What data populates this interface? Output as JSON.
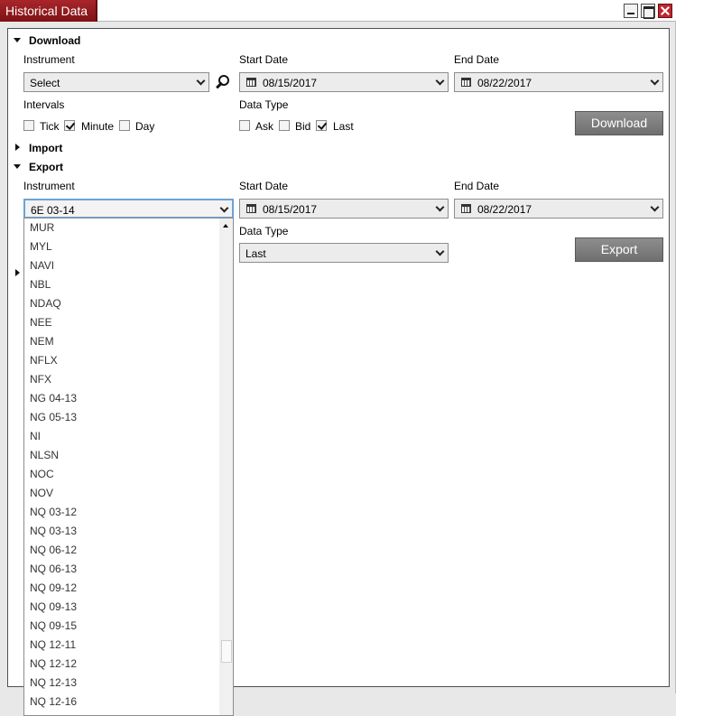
{
  "window": {
    "title": "Historical Data"
  },
  "download": {
    "section_title": "Download",
    "instrument_label": "Instrument",
    "instrument_value": "Select",
    "start_date_label": "Start Date",
    "start_date_value": "08/15/2017",
    "end_date_label": "End Date",
    "end_date_value": "08/22/2017",
    "intervals_label": "Intervals",
    "intervals": [
      {
        "label": "Tick",
        "checked": false
      },
      {
        "label": "Minute",
        "checked": true
      },
      {
        "label": "Day",
        "checked": false
      }
    ],
    "data_type_label": "Data Type",
    "data_types": [
      {
        "label": "Ask",
        "checked": false
      },
      {
        "label": "Bid",
        "checked": false
      },
      {
        "label": "Last",
        "checked": true
      }
    ],
    "button_label": "Download"
  },
  "import": {
    "section_title": "Import"
  },
  "export": {
    "section_title": "Export",
    "instrument_label": "Instrument",
    "instrument_value": "6E 03-14",
    "start_date_label": "Start Date",
    "start_date_value": "08/15/2017",
    "end_date_label": "End Date",
    "end_date_value": "08/22/2017",
    "data_type_label": "Data Type",
    "data_type_value": "Last",
    "button_label": "Export"
  },
  "instrument_dropdown": {
    "items": [
      "MUR",
      "MYL",
      "NAVI",
      "NBL",
      "NDAQ",
      "NEE",
      "NEM",
      "NFLX",
      "NFX",
      "NG 04-13",
      "NG 05-13",
      "NI",
      "NLSN",
      "NOC",
      "NOV",
      "NQ 03-12",
      "NQ 03-13",
      "NQ 06-12",
      "NQ 06-13",
      "NQ 09-12",
      "NQ 09-13",
      "NQ 09-15",
      "NQ 12-11",
      "NQ 12-12",
      "NQ 12-13",
      "NQ 12-16"
    ]
  },
  "icons": {
    "search": "search-icon",
    "calendar": "calendar-icon",
    "chevron": "chevron-down-icon"
  },
  "colors": {
    "title_accent": "#8e1a1e",
    "button": "#7c7c7c",
    "focus_border": "#6aa4d8"
  }
}
